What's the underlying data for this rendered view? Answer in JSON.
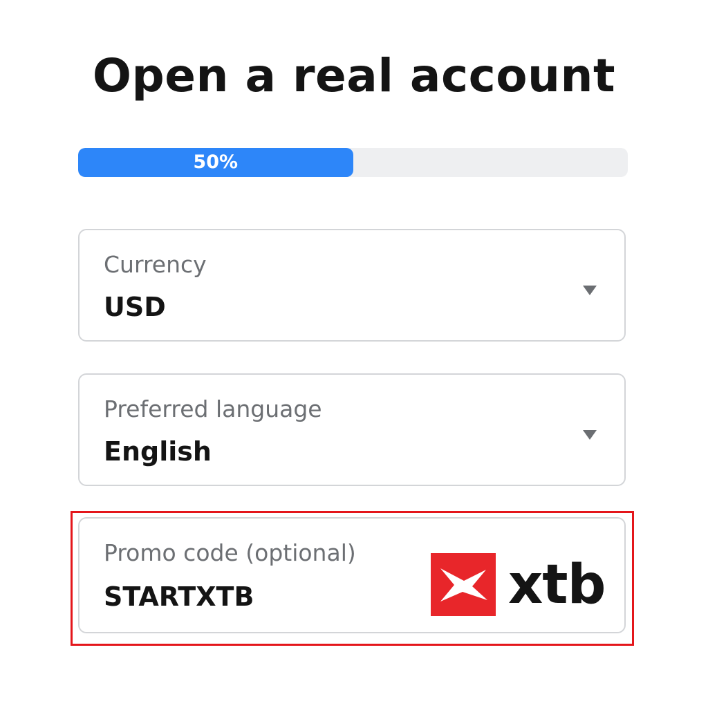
{
  "page": {
    "title": "Open a real account"
  },
  "progress": {
    "label": "50%",
    "value": 0.5,
    "fill_color": "#2d86f9",
    "track_color": "#eeeff1"
  },
  "fields": {
    "currency": {
      "label": "Currency",
      "value": "USD",
      "icon": "chevron-down-icon"
    },
    "language": {
      "label": "Preferred language",
      "value": "English",
      "icon": "chevron-down-icon"
    },
    "promo": {
      "label": "Promo code (optional)",
      "value": "STARTXTB"
    }
  },
  "brand": {
    "logo_text": "xtb",
    "mark_color": "#e8262a",
    "highlight_color": "#e4161b"
  }
}
